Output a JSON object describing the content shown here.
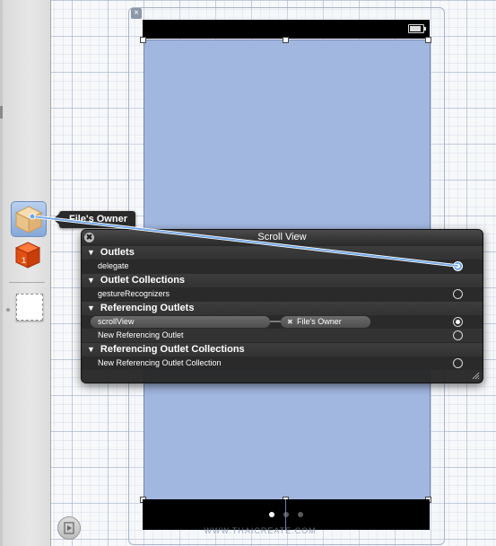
{
  "tooltip": {
    "label": "File's Owner"
  },
  "hud": {
    "title": "Scroll View",
    "close_glyph": "✖",
    "sections": {
      "outlets": {
        "label": "Outlets",
        "rows": [
          "delegate"
        ]
      },
      "outlet_collections": {
        "label": "Outlet Collections",
        "rows": [
          "gestureRecognizers"
        ]
      },
      "referencing_outlets": {
        "label": "Referencing Outlets",
        "connection": {
          "outlet": "scrollView",
          "target": "File's Owner",
          "remove_glyph": "✖"
        },
        "new_label": "New Referencing Outlet"
      },
      "referencing_outlet_collections": {
        "label": "Referencing Outlet Collections",
        "new_label": "New Referencing Outlet Collection"
      }
    }
  },
  "icons": {
    "files_owner": "files-owner-cube-icon",
    "first_responder": "first-responder-cube-icon",
    "view": "view-object-icon",
    "battery": "battery-icon",
    "dock_toggle": "play-toggle-icon",
    "disclosure": "disclosure-triangle-icon"
  },
  "colors": {
    "scroll_view_fill": "#a2b7df",
    "connection_line": "#6fa6e6",
    "hud_background": "#262626"
  },
  "page_control": {
    "pages": 3,
    "current": 1
  },
  "watermark": "WWW.THAICREATE.COM"
}
